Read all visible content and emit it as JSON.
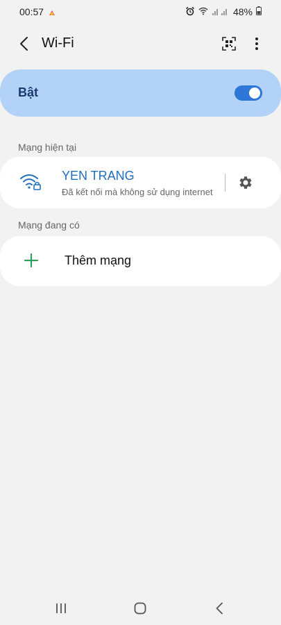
{
  "status_bar": {
    "time": "00:57",
    "battery": "48%",
    "icons": [
      "notification-icon",
      "alarm-icon",
      "wifi-signal-icon",
      "cell-signal-icon",
      "battery-icon"
    ]
  },
  "app_bar": {
    "title": "Wi-Fi",
    "icons": [
      "back-arrow-icon",
      "qr-scan-icon",
      "more-vert-icon"
    ]
  },
  "toggle": {
    "label": "Bật",
    "state": "on",
    "accent": "#2f76d9",
    "background": "#b2d3f7"
  },
  "current_network": {
    "header": "Mạng hiện tại",
    "name": "YEN TRANG",
    "status": "Đã kết nối mà không sử dụng internet",
    "icon": "wifi-lock-icon",
    "settings_icon": "gear-icon"
  },
  "available": {
    "header": "Mạng đang có",
    "add_label": "Thêm mạng",
    "add_icon": "plus-icon"
  },
  "nav_bar": {
    "icons": [
      "recent-apps-icon",
      "home-icon",
      "back-icon"
    ]
  }
}
